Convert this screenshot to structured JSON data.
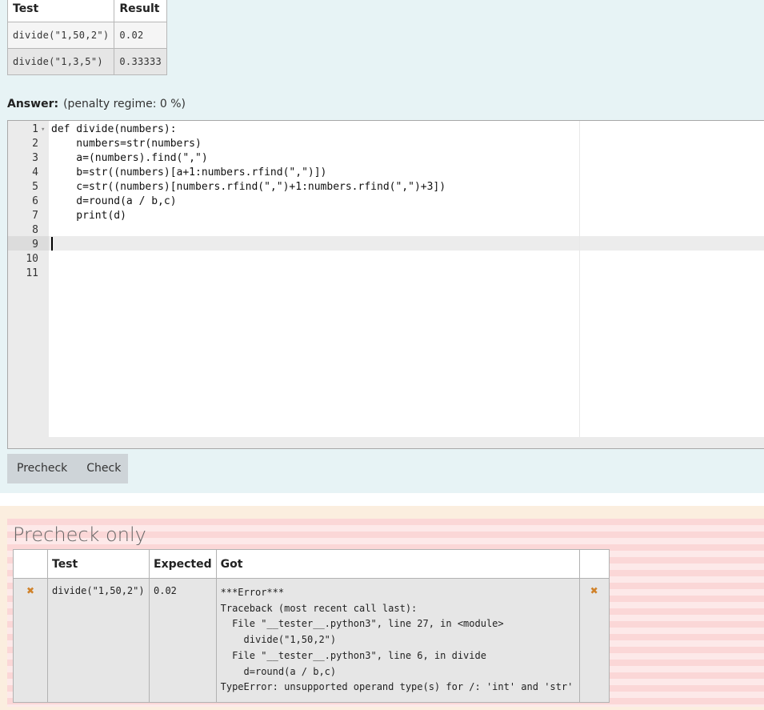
{
  "examples": {
    "headers": [
      "Test",
      "Result"
    ],
    "rows": [
      {
        "test": "divide(\"1,50,2\")",
        "result": "0.02"
      },
      {
        "test": "divide(\"1,3,5\")",
        "result": "0.33333"
      }
    ]
  },
  "answer": {
    "label": "Answer:",
    "penalty": "(penalty regime: 0 %)"
  },
  "editor": {
    "line_numbers": [
      "1",
      "2",
      "3",
      "4",
      "5",
      "6",
      "7",
      "8",
      "9",
      "10",
      "11"
    ],
    "active_line": 9,
    "code": [
      "def divide(numbers):",
      "    numbers=str(numbers)",
      "    a=(numbers).find(\",\")",
      "    b=str((numbers)[a+1:numbers.rfind(\",\")])",
      "    c=str((numbers)[numbers.rfind(\",\")+1:numbers.rfind(\",\")+3])",
      "    d=round(a / b,c)",
      "    print(d)",
      "",
      "",
      "",
      ""
    ]
  },
  "buttons": {
    "precheck": "Precheck",
    "check": "Check"
  },
  "result": {
    "title": "Precheck only",
    "headers": [
      "",
      "Test",
      "Expected",
      "Got",
      ""
    ],
    "rows": [
      {
        "test": "divide(\"1,50,2\")",
        "expected": "0.02",
        "got": [
          "***Error***",
          "Traceback (most recent call last):",
          "  File \"__tester__.python3\", line 27, in <module>",
          "    divide(\"1,50,2\")",
          "  File \"__tester__.python3\", line 6, in divide",
          "    d=round(a / b,c)",
          "TypeError: unsupported operand type(s) for /: 'int' and 'str'"
        ],
        "status_icon": "cross-icon"
      }
    ],
    "colors": {
      "fail_mark": "#d0822a",
      "stripe_a": "#fbd7d7",
      "stripe_b": "#fde9e9"
    }
  }
}
